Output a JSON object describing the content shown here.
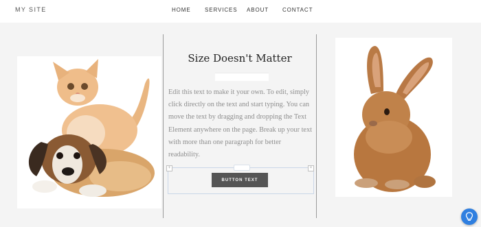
{
  "site": {
    "logo": "MY SITE"
  },
  "nav": {
    "items": [
      "HOME",
      "SERVICES",
      "ABOUT",
      "CONTACT"
    ]
  },
  "main": {
    "title": "Size Doesn't Matter",
    "paragraph": "Edit this text to make it your own. To edit, simply click directly on the text and start typing. You can move the text by dragging and dropping the Text Element anywhere on the page. Break up your text with more than one paragraph for better readability.",
    "button_label": "BUTTON TEXT"
  },
  "images": {
    "left": "kitten and puppy photo",
    "right": "brown rabbit photo"
  },
  "icons": {
    "help": "lightbulb-icon"
  },
  "colors": {
    "accent": "#2f7fe0",
    "button": "#555555",
    "divider": "#9a9a9a"
  }
}
